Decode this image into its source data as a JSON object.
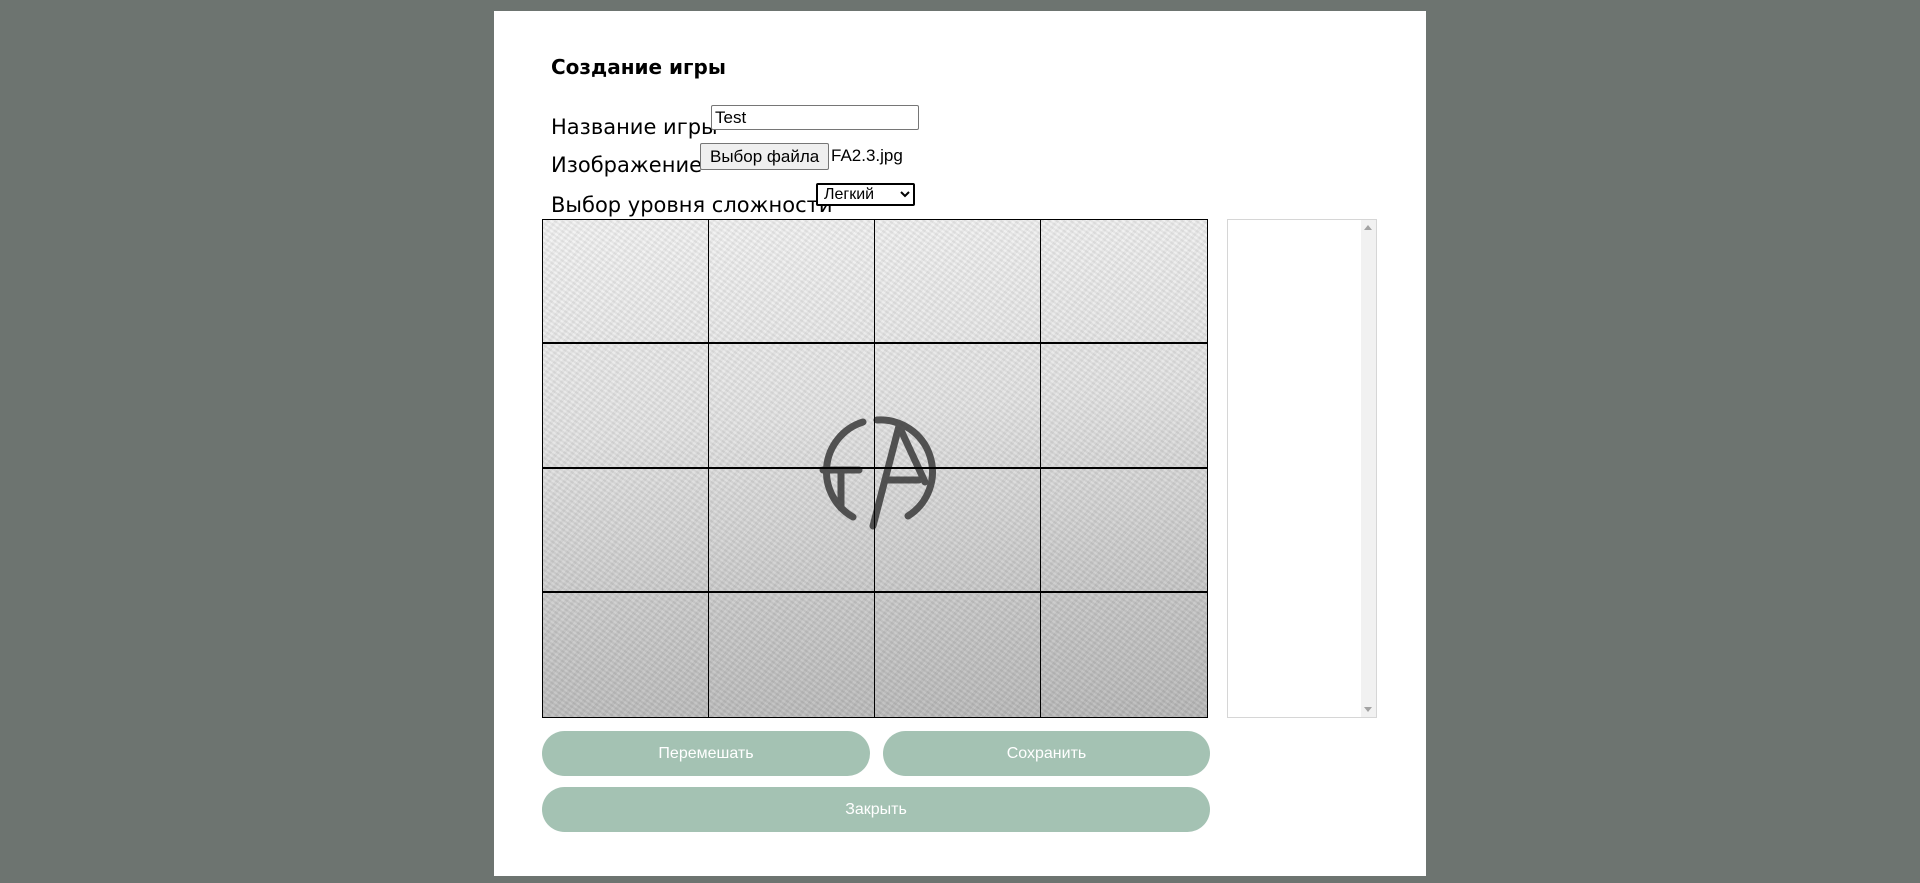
{
  "form": {
    "title": "Создание игры",
    "name_label": "Название игры",
    "name_value": "Test",
    "image_label": "Изображение",
    "file_button_label": "Выбор файла",
    "file_name": "FA2.3.jpg",
    "level_label": "Выбор уровня сложности",
    "level_selected": "Легкий"
  },
  "puzzle": {
    "rows": 4,
    "cols": 4,
    "image_icon": "fa-logo-emboss"
  },
  "buttons": {
    "shuffle_label": "Перемешать",
    "save_label": "Сохранить",
    "close_label": "Закрыть"
  },
  "colors": {
    "backdrop": "#6d7470",
    "button_fill": "#a4c2b3",
    "button_text": "#ffffff"
  }
}
